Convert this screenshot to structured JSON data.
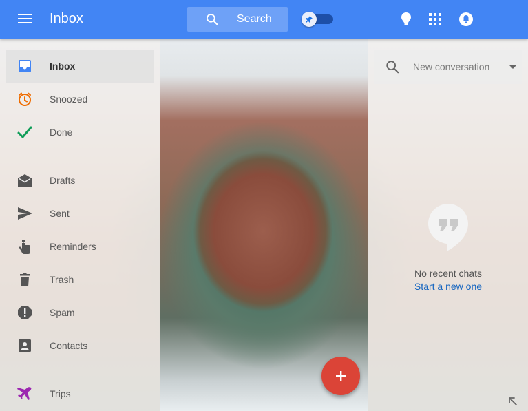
{
  "header": {
    "app_title": "Inbox",
    "search_label": "Search",
    "menu_icon": "menu-icon",
    "pin_toggle": {
      "on": true,
      "icon": "pin-icon"
    },
    "right_icons": [
      "reminder-bulb-icon",
      "apps-grid-icon",
      "notifications-icon"
    ]
  },
  "sidebar": {
    "items": [
      {
        "label": "Inbox",
        "icon": "inbox-icon",
        "active": true
      },
      {
        "label": "Snoozed",
        "icon": "clock-icon"
      },
      {
        "label": "Done",
        "icon": "check-icon"
      },
      {
        "label": "Drafts",
        "icon": "drafts-icon"
      },
      {
        "label": "Sent",
        "icon": "send-icon"
      },
      {
        "label": "Reminders",
        "icon": "reminder-hand-icon"
      },
      {
        "label": "Trash",
        "icon": "trash-icon"
      },
      {
        "label": "Spam",
        "icon": "spam-icon"
      },
      {
        "label": "Contacts",
        "icon": "contacts-icon"
      },
      {
        "label": "Trips",
        "icon": "airplane-icon"
      }
    ]
  },
  "chat": {
    "search_placeholder": "New conversation",
    "empty_text": "No recent chats",
    "start_link": "Start a new one"
  },
  "fab": {
    "icon": "plus-icon"
  },
  "colors": {
    "header": "#4285f4",
    "fab": "#db4437",
    "snoozed": "#ef6c00",
    "done": "#0f9d58",
    "inbox": "#4285f4",
    "trips": "#9c27b0",
    "link": "#1565c0"
  }
}
